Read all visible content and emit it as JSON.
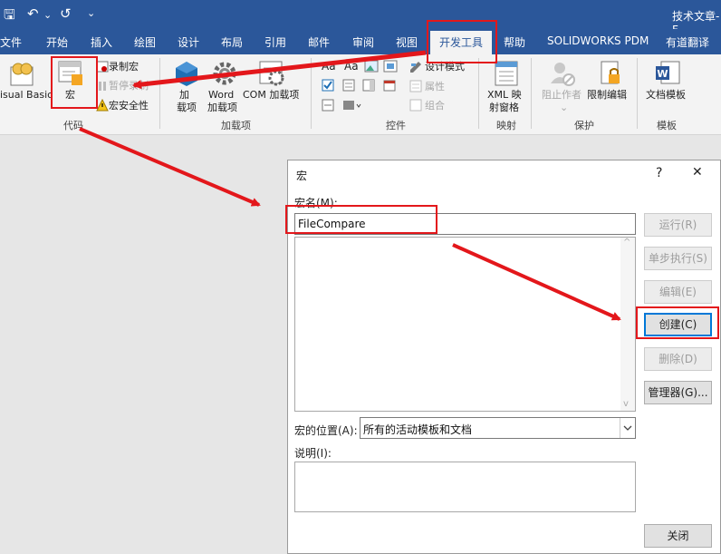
{
  "titlebar": {
    "title": "技术文章-F",
    "qat": {
      "save": "🖫",
      "undo": "↶",
      "redo": "↺",
      "more": "⌄"
    }
  },
  "tabs": [
    "文件",
    "开始",
    "插入",
    "绘图",
    "设计",
    "布局",
    "引用",
    "邮件",
    "审阅",
    "视图",
    "开发工具",
    "帮助",
    "SOLIDWORKS PDM",
    "有道翻译"
  ],
  "active_tab": "开发工具",
  "ribbon": {
    "code": {
      "visual_basic": "isual Basic",
      "macros": "宏",
      "record_macro": "录制宏",
      "pause_recording": "暂停录制",
      "macro_security": "宏安全性",
      "label": "代码"
    },
    "addins": {
      "addins_line1": "加",
      "addins_line2": "载项",
      "word_line1": "Word",
      "word_line2": "加载项",
      "com": "COM 加载项",
      "label": "加载项"
    },
    "controls": {
      "design_mode": "设计模式",
      "properties": "属性",
      "group": "组合",
      "label": "控件"
    },
    "mapping": {
      "xml_line1": "XML 映",
      "xml_line2": "射窗格",
      "label": "映射"
    },
    "protect": {
      "block_authors_line1": "阻止作者",
      "restrict_editing": "限制编辑",
      "label": "保护"
    },
    "templates": {
      "doc_template": "文档模板",
      "label": "模板"
    }
  },
  "dialog": {
    "title": "宏",
    "help": "?",
    "close": "✕",
    "macro_name_label": "宏名(M):",
    "macro_name_value": "FileCompare",
    "macros_in_label": "宏的位置(A):",
    "macros_in_value": "所有的活动模板和文档",
    "description_label": "说明(I):",
    "buttons": {
      "run": "运行(R)",
      "step_into": "单步执行(S)",
      "edit": "编辑(E)",
      "create": "创建(C)",
      "delete": "删除(D)",
      "organizer": "管理器(G)...",
      "close": "关闭"
    }
  },
  "colors": {
    "accent": "#2b579a",
    "highlight": "#e3171b",
    "focus": "#0078d7"
  }
}
